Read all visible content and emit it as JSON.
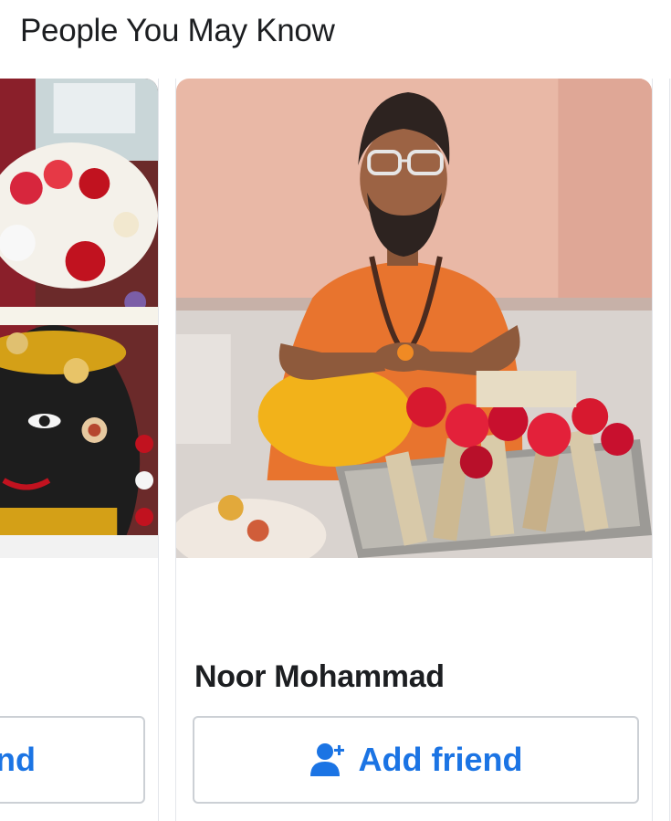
{
  "section": {
    "title": "People You May Know"
  },
  "cards": [
    {
      "name": "",
      "button_label": "nd",
      "button_icon": "none",
      "photo": "deity-idol-photo"
    },
    {
      "name": "Noor Mohammad",
      "button_label": "Add friend",
      "button_icon": "add-friend-icon",
      "photo": "man-performing-ritual-photo"
    }
  ],
  "colors": {
    "accent": "#1b74e4",
    "text": "#1c1e21",
    "border": "#ccd0d5"
  }
}
